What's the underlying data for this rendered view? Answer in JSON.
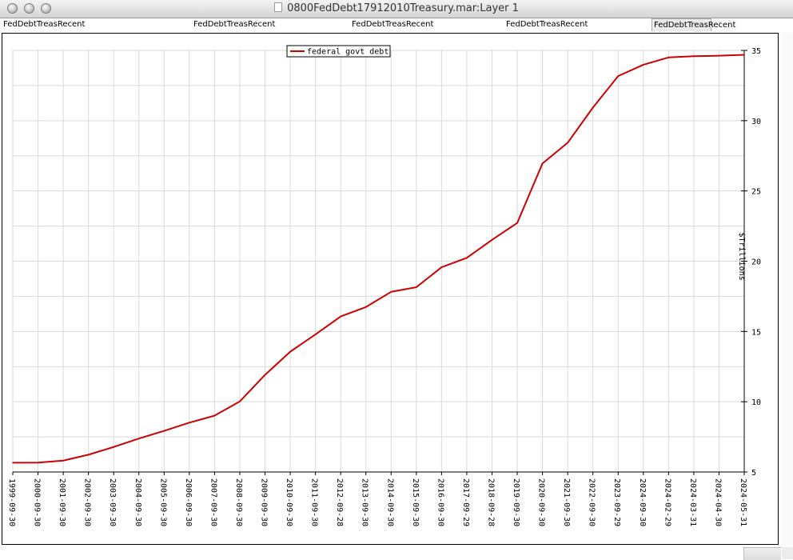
{
  "window": {
    "title": "0800FedDebt17912010Treasury.mar:Layer 1"
  },
  "tabs": [
    {
      "label": "FedDebtTreasRecent"
    },
    {
      "label": "FedDebtTreasRecent"
    },
    {
      "label": "FedDebtTreasRecent"
    },
    {
      "label": "FedDebtTreasRecent"
    },
    {
      "label": "FedDebtTreasRecent"
    }
  ],
  "colors": {
    "series": "#cc0000",
    "grid": "#d9d9d9",
    "axis": "#000000"
  },
  "chart_data": {
    "type": "line",
    "title": "",
    "xlabel": "",
    "ylabel": "$Trillions",
    "y_axis_side": "right",
    "ylim": [
      5,
      35
    ],
    "yticks": [
      5,
      10,
      15,
      20,
      25,
      30,
      35
    ],
    "grid": true,
    "legend": "top-center",
    "x": [
      "1999-09-30",
      "2000-09-30",
      "2001-09-30",
      "2002-09-30",
      "2003-09-30",
      "2004-09-30",
      "2005-09-30",
      "2006-09-30",
      "2007-09-30",
      "2008-09-30",
      "2009-09-30",
      "2010-09-30",
      "2011-09-30",
      "2012-09-28",
      "2013-09-30",
      "2014-09-30",
      "2015-09-30",
      "2016-09-30",
      "2017-09-29",
      "2018-09-28",
      "2019-09-30",
      "2020-09-30",
      "2021-09-30",
      "2022-09-30",
      "2023-09-29",
      "2024-09-30",
      "2024-02-29",
      "2024-03-31",
      "2024-04-30",
      "2024-05-31"
    ],
    "series": [
      {
        "name": "federal govt debt",
        "values": [
          5.66,
          5.67,
          5.81,
          6.23,
          6.78,
          7.38,
          7.93,
          8.51,
          9.01,
          10.02,
          11.91,
          13.56,
          14.79,
          16.07,
          16.74,
          17.82,
          18.15,
          19.57,
          20.24,
          21.52,
          22.72,
          26.95,
          28.43,
          30.93,
          33.17,
          33.98,
          34.5,
          34.59,
          34.62,
          34.69
        ]
      }
    ]
  }
}
